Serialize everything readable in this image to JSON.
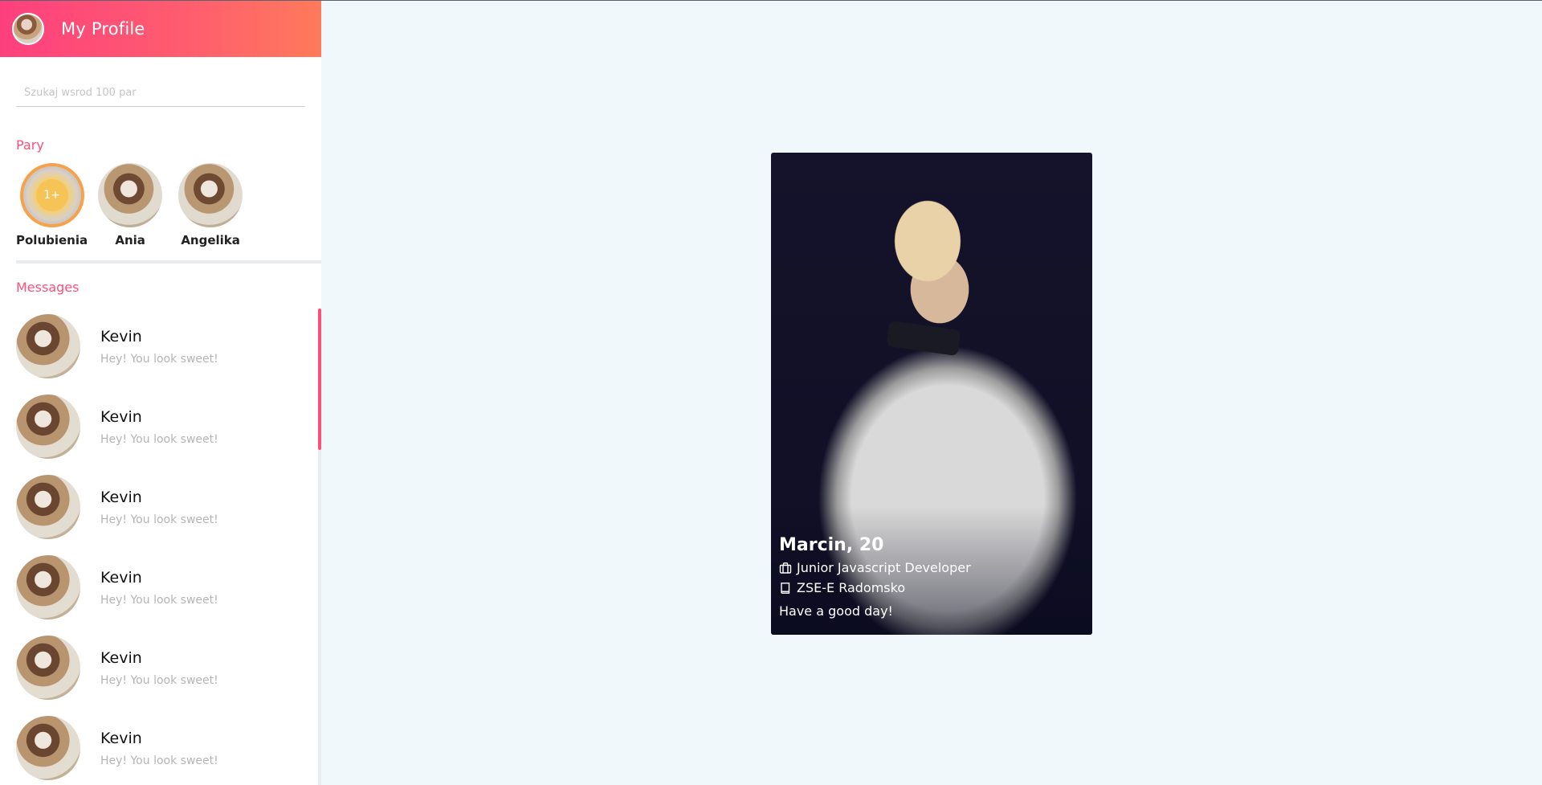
{
  "header": {
    "title": "My Profile"
  },
  "search": {
    "placeholder": "Szukaj wsrod 100 par"
  },
  "pairs": {
    "title": "Pary",
    "likes": {
      "badge": "1+",
      "label": "Polubienia"
    },
    "items": [
      {
        "name": "Ania"
      },
      {
        "name": "Angelika"
      }
    ]
  },
  "messages": {
    "title": "Messages",
    "items": [
      {
        "name": "Kevin",
        "preview": "Hey! You look sweet!"
      },
      {
        "name": "Kevin",
        "preview": "Hey! You look sweet!"
      },
      {
        "name": "Kevin",
        "preview": "Hey! You look sweet!"
      },
      {
        "name": "Kevin",
        "preview": "Hey! You look sweet!"
      },
      {
        "name": "Kevin",
        "preview": "Hey! You look sweet!"
      },
      {
        "name": "Kevin",
        "preview": "Hey! You look sweet!"
      }
    ]
  },
  "card": {
    "name": "Marcin, 20",
    "job": "Junior Javascript Developer",
    "school": "ZSE-E Radomsko",
    "bio": "Have a good day!",
    "job_icon": "briefcase-icon",
    "school_icon": "book-icon"
  },
  "colors": {
    "accent": "#fd4f78",
    "header_gradient_start": "#fd3f7e",
    "header_gradient_end": "#ff7a5a",
    "likes_ring": "#f7a24a",
    "background": "#f1f8fb"
  }
}
